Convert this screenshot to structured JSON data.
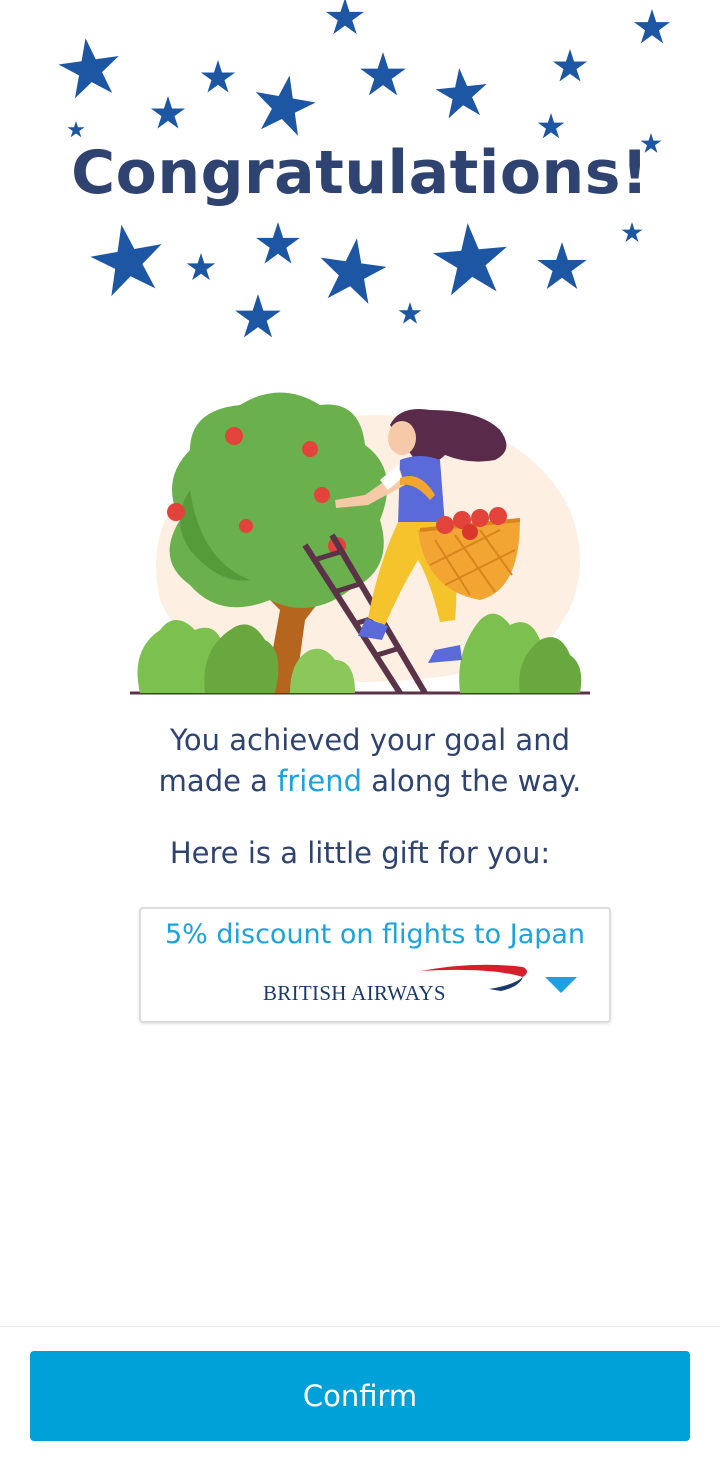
{
  "header": {
    "title": "Congratulations!"
  },
  "message": {
    "line1": "You achieved your goal and",
    "line2_prefix": "made a ",
    "line2_highlight": "friend",
    "line2_suffix": " along the way.",
    "gift_line": "Here is a little gift for you:"
  },
  "offer": {
    "title": "5% discount on flights to Japan",
    "brand": "BRITISH AIRWAYS"
  },
  "footer": {
    "confirm_label": "Confirm"
  },
  "icons": {
    "stars": "star-icon",
    "expand": "chevron-down-icon",
    "illustration": "apple-picking-illustration",
    "brand_logo": "british-airways-logo"
  },
  "colors": {
    "title": "#2f4371",
    "star": "#1d57a3",
    "accent": "#1aa3e0",
    "button": "#00a0d8"
  }
}
